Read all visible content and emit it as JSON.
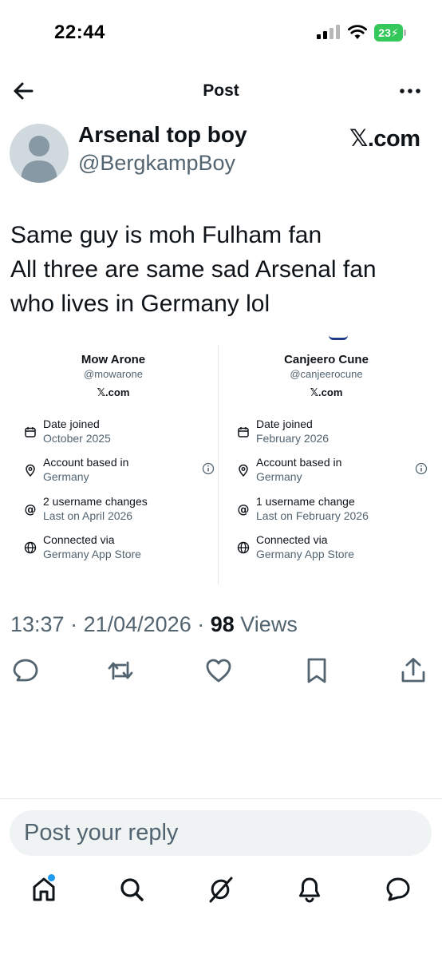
{
  "status_bar": {
    "time": "22:44",
    "battery": "23"
  },
  "header": {
    "title": "Post"
  },
  "author": {
    "name": "Arsenal top boy",
    "handle": "@BergkampBoy",
    "brand": "𝕏.com"
  },
  "tweet": {
    "lines": [
      "Same guy is moh Fulham fan",
      "All three are same sad Arsenal fan",
      "who lives in Germany lol"
    ]
  },
  "cards": [
    {
      "name": "Mow Arone",
      "handle": "@mowarone",
      "brand": "𝕏.com",
      "date_title": "Date joined",
      "date_value": "October 2025",
      "based_title": "Account based in",
      "based_value": "Germany",
      "username_title": "2 username changes",
      "username_value": "Last on April 2026",
      "connected_title": "Connected via",
      "connected_value": "Germany App Store"
    },
    {
      "name": "Canjeero Cune",
      "handle": "@canjeerocune",
      "brand": "𝕏.com",
      "date_title": "Date joined",
      "date_value": "February 2026",
      "based_title": "Account based in",
      "based_value": "Germany",
      "username_title": "1 username change",
      "username_value": "Last on February 2026",
      "connected_title": "Connected via",
      "connected_value": "Germany App Store"
    }
  ],
  "meta": {
    "time": "13:37",
    "date": "21/04/2026",
    "views_count": "98",
    "views_label": "Views",
    "sep": " · "
  },
  "actions": [
    "reply-icon",
    "retweet-icon",
    "like-icon",
    "bookmark-icon",
    "share-icon"
  ],
  "reply": {
    "placeholder": "Post your reply"
  },
  "tabs": [
    "home-icon",
    "search-icon",
    "grok-icon",
    "notifications-icon",
    "messages-icon"
  ],
  "colors": {
    "accent": "#1d9bf0",
    "text": "#0f1419",
    "secondary": "#536471",
    "battery": "#34c759"
  }
}
